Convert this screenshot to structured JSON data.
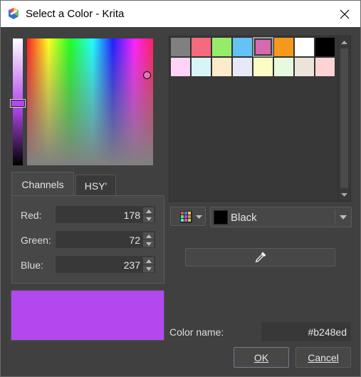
{
  "window": {
    "title": "Select a Color - Krita"
  },
  "selector": {
    "current_color": "#b248ed"
  },
  "tabs": [
    {
      "label": "Channels"
    },
    {
      "label": "HSY'"
    }
  ],
  "channels": {
    "red": {
      "label": "Red:",
      "value": "178"
    },
    "green": {
      "label": "Green:",
      "value": "72"
    },
    "blue": {
      "label": "Blue:",
      "value": "237"
    }
  },
  "palette": {
    "swatches": [
      "#808080",
      "#f46a7e",
      "#96ec6a",
      "#64c2f4",
      "#d869ae",
      "#f4991c",
      "#ffffff",
      "#000000",
      "#ffd3f8",
      "#d8f4f6",
      "#fdebca",
      "#e7e8f8",
      "#fdfcc4",
      "#e7f9df",
      "#ede4d9",
      "#fdd3d3"
    ],
    "selected_index": 4,
    "combo_value": "Black",
    "combo_color": "#000000"
  },
  "color_name": {
    "label": "Color name:",
    "value": "#b248ed"
  },
  "buttons": {
    "ok": "OK",
    "cancel": "Cancel"
  }
}
